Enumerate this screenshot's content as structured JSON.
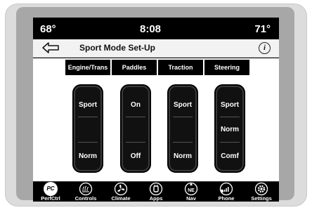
{
  "status": {
    "temp_left": "68°",
    "clock": "8:08",
    "temp_right": "71°"
  },
  "title_bar": {
    "title": "Sport Mode Set-Up",
    "info_glyph": "i"
  },
  "tabs": [
    {
      "label": "Engine/Trans"
    },
    {
      "label": "Paddles"
    },
    {
      "label": "Traction"
    },
    {
      "label": "Steering"
    }
  ],
  "switches": [
    {
      "top": "Sport",
      "bottom": "Norm"
    },
    {
      "top": "On",
      "bottom": "Off"
    },
    {
      "top": "Sport",
      "bottom": "Norm"
    },
    {
      "top": "Sport",
      "middle": "Norm",
      "bottom": "Comf"
    }
  ],
  "nav": [
    {
      "label": "PerfCtrl",
      "badge": "PC",
      "icon": "perfctrl-icon"
    },
    {
      "label": "Controls",
      "icon": "controls-icon"
    },
    {
      "label": "Climate",
      "icon": "climate-icon"
    },
    {
      "label": "Apps",
      "icon": "apps-icon"
    },
    {
      "label": "Nav",
      "badge": "NE",
      "icon": "compass-icon"
    },
    {
      "label": "Phone",
      "icon": "phone-icon"
    },
    {
      "label": "Settings",
      "icon": "gear-icon"
    }
  ]
}
